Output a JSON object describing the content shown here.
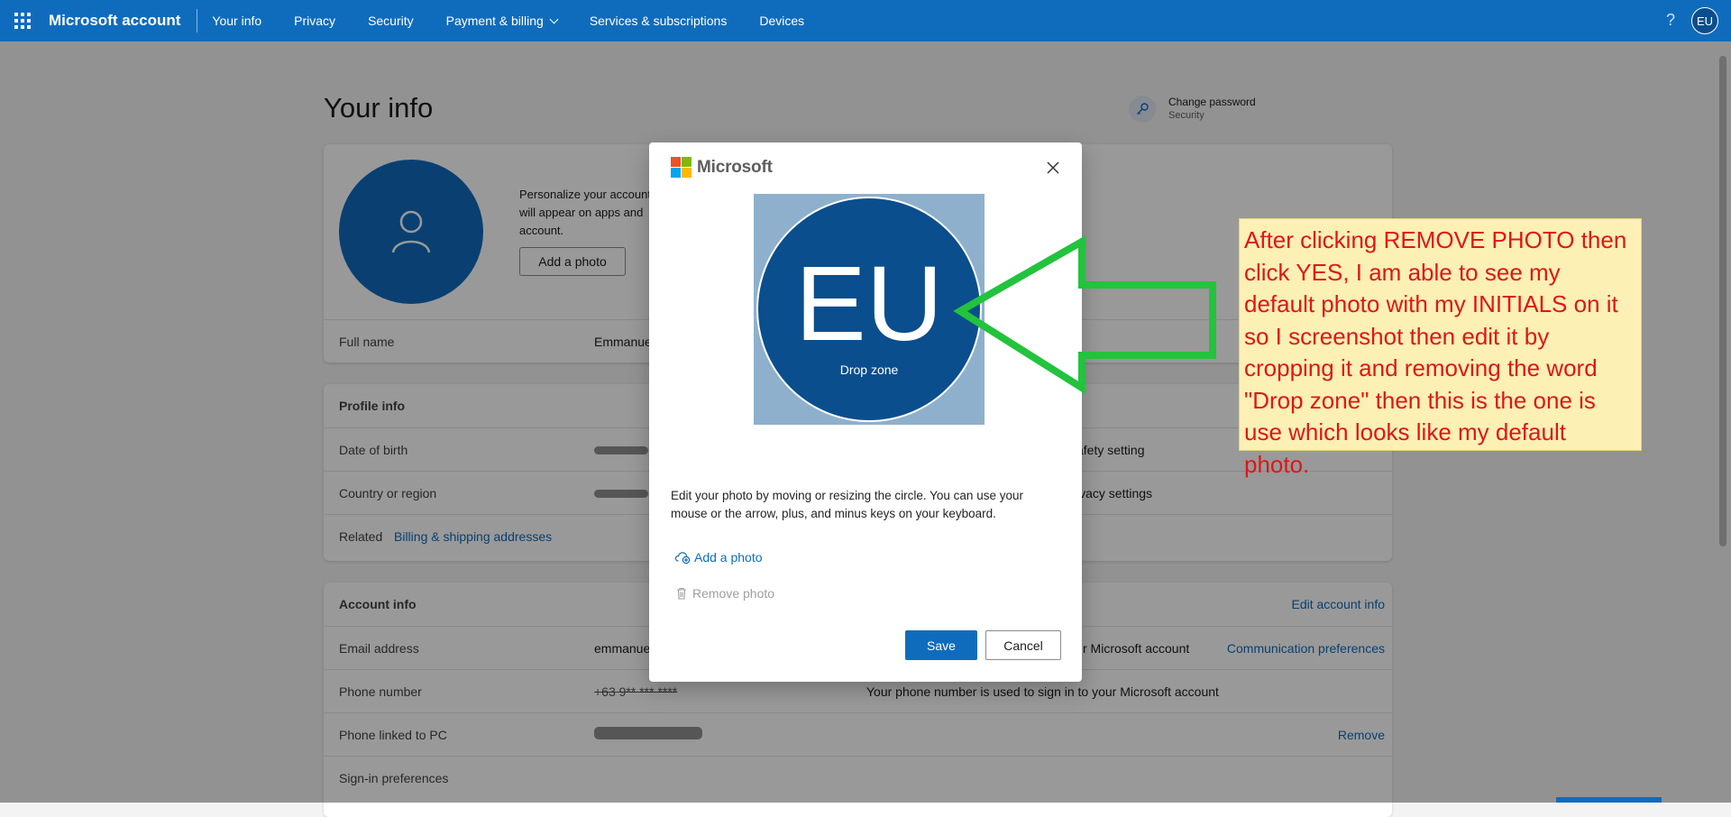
{
  "nav": {
    "brand": "Microsoft account",
    "items": [
      "Your info",
      "Privacy",
      "Security",
      "Payment & billing",
      "Services & subscriptions",
      "Devices"
    ],
    "help": "?",
    "avatar_initials": "EU"
  },
  "page": {
    "title": "Your info",
    "change_password": {
      "label": "Change password",
      "sub": "Security"
    }
  },
  "profile_card": {
    "personalize_text": "Personalize your account\nwill appear on apps and\naccount.",
    "add_photo_button": "Add a photo",
    "full_name_label": "Full name",
    "full_name_value": "Emmanue"
  },
  "profile_info": {
    "title": "Profile info",
    "dob_label": "Date of birth",
    "dob_right": "afety setting",
    "country_label": "Country or region",
    "country_right": "ivacy settings",
    "related_label": "Related",
    "related_link": "Billing & shipping addresses"
  },
  "account_info": {
    "title": "Account info",
    "edit_link": "Edit account info",
    "email_label": "Email address",
    "email_value": "emmanue",
    "email_desc": "r Microsoft account",
    "email_link": "Communication preferences",
    "phone_label": "Phone number",
    "phone_value": "+63 9** *** ****",
    "phone_desc": "Your phone number is used to sign in to your Microsoft account",
    "pc_label": "Phone linked to PC",
    "pc_link": "Remove",
    "signin_link": "Sign-in preferences"
  },
  "dialog": {
    "brand": "Microsoft",
    "initials": "EU",
    "drop_zone": "Drop zone",
    "description": "Edit your photo by moving or resizing the circle. You can use your mouse or the arrow, plus, and minus keys on your keyboard.",
    "add_photo": "Add a photo",
    "remove_photo": "Remove photo",
    "save": "Save",
    "cancel": "Cancel"
  },
  "annotation": {
    "text": "After clicking REMOVE PHOTO then click YES, I am able to see my default photo with my INITIALS on it so I screenshot then edit it by cropping it and removing the word \"Drop zone\" then this is the one is use which looks like my default photo."
  },
  "colors": {
    "accent": "#0f6cbd",
    "annotation_text": "#e01616",
    "annotation_bg": "#fdf0b4",
    "arrow": "#22c33d"
  }
}
